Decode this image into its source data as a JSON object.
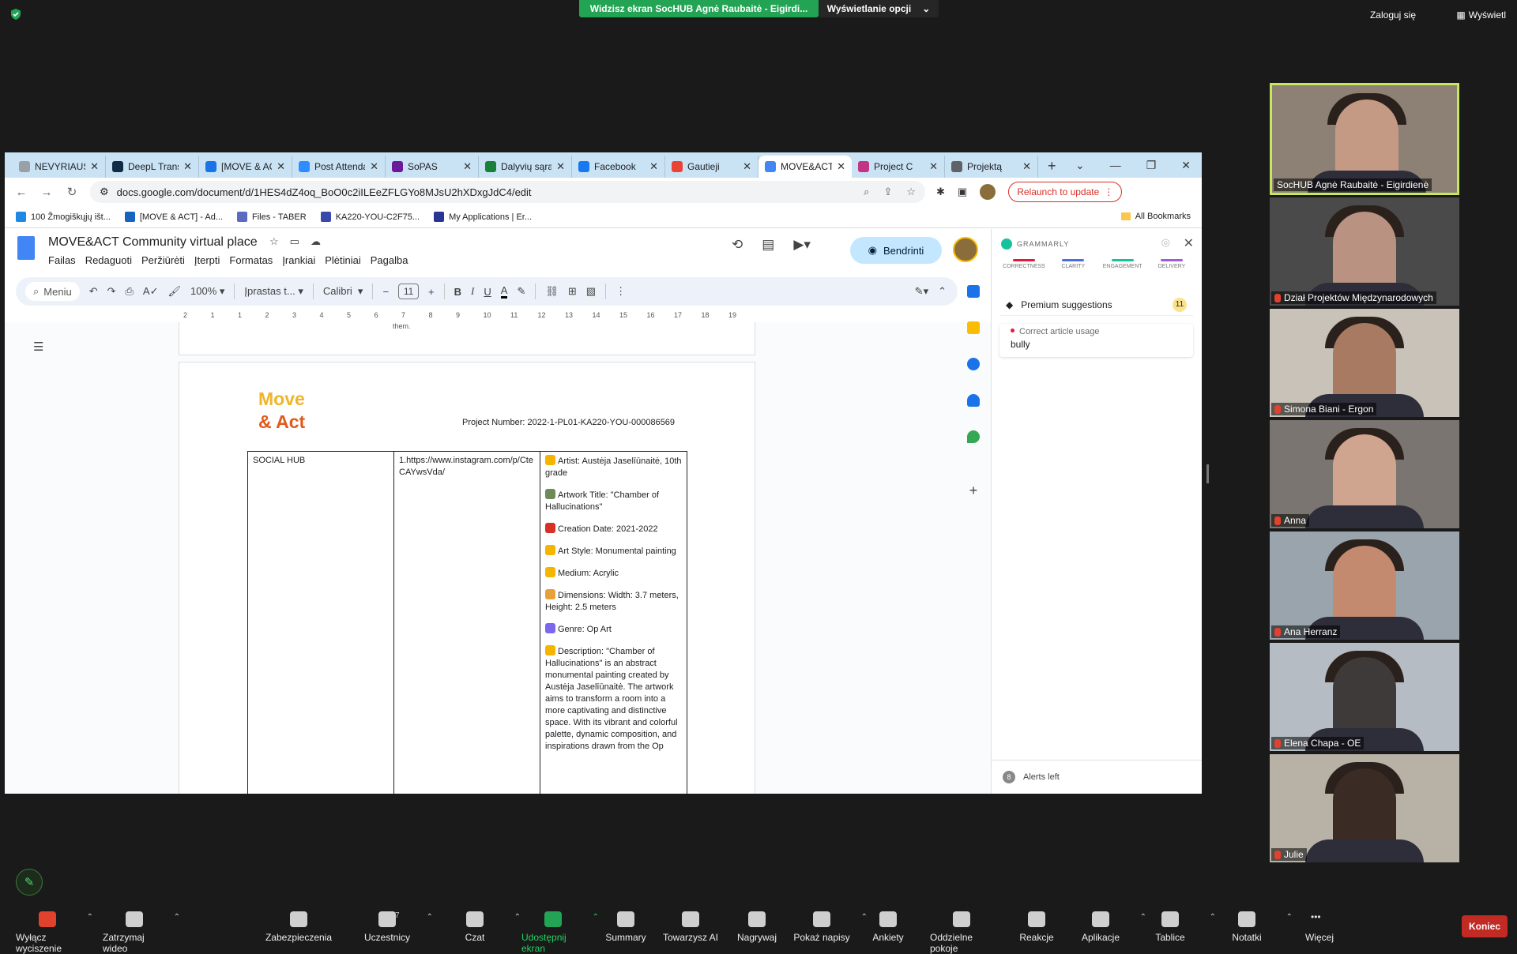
{
  "zoom_top": {
    "share_banner": "Widzisz ekran SocHUB Agnė Raubaitė - Eigirdi...",
    "view_options": "Wyświetlanie opcji",
    "login": "Zaloguj się",
    "show": "Wyświetl"
  },
  "browser": {
    "tabs": [
      {
        "label": "NEVYRIAUSYB",
        "color": "#9aa0a6"
      },
      {
        "label": "DeepL Translate",
        "color": "#0f2b46"
      },
      {
        "label": "[MOVE & ACT]",
        "color": "#1a73e8"
      },
      {
        "label": "Post Attendance",
        "color": "#2d8cff"
      },
      {
        "label": "SoPAS",
        "color": "#6a1b9a"
      },
      {
        "label": "Dalyvių sąrašas",
        "color": "#188038"
      },
      {
        "label": "Facebook",
        "color": "#1877f2"
      },
      {
        "label": "Gautieji",
        "color": "#ea4335"
      },
      {
        "label": "MOVE&ACT",
        "color": "#4285f4"
      },
      {
        "label": "Project C",
        "color": "#c13584"
      },
      {
        "label": "Projektą",
        "color": "#5f6368"
      }
    ],
    "url": "docs.google.com/document/d/1HES4dZ4oq_BoO0c2iILEeZFLGYo8MJsU2hXDxgJdC4/edit",
    "relaunch": "Relaunch to update",
    "bookmarks": [
      {
        "label": "100 Žmogiškųjų išt...",
        "color": "#1e88e5"
      },
      {
        "label": "[MOVE & ACT] - Ad...",
        "color": "#1565c0"
      },
      {
        "label": "Files - TABER",
        "color": "#5c6bc0"
      },
      {
        "label": "KA220-YOU-C2F75...",
        "color": "#3949ab"
      },
      {
        "label": "My Applications | Er...",
        "color": "#283593"
      }
    ],
    "all_bookmarks": "All Bookmarks"
  },
  "docs": {
    "title": "MOVE&ACT Community virtual place",
    "menu": [
      "Failas",
      "Redaguoti",
      "Peržiūrėti",
      "Įterpti",
      "Formatas",
      "Įrankiai",
      "Plėtiniai",
      "Pagalba"
    ],
    "share": "Bendrinti",
    "toolbar": {
      "search": "Meniu",
      "zoom": "100%",
      "style": "Įprastas t...",
      "font": "Calibri",
      "size": "11"
    },
    "ruler": [
      "2",
      "1",
      "1",
      "2",
      "3",
      "4",
      "5",
      "6",
      "7",
      "8",
      "9",
      "10",
      "11",
      "12",
      "13",
      "14",
      "15",
      "16",
      "17",
      "18",
      "19"
    ],
    "prev_page_text": "them.",
    "logo_line1": "Move",
    "logo_line2": "& Act",
    "project_number": "Project Number: 2022-1-PL01-KA220-YOU-000086569",
    "table": {
      "col1": "SOCIAL HUB",
      "col2": "1.https://www.instagram.com/p/CteCAYwsVda/",
      "col3": [
        {
          "text": "Artist: Austėja Jaselīūnaitė, 10th grade",
          "icon": "palette",
          "color": "#f4b400"
        },
        {
          "text": "Artwork Title: \"Chamber of Hallucinations\"",
          "icon": "framed-picture",
          "color": "#6d8b5a"
        },
        {
          "text": "Creation Date: 2021-2022",
          "icon": "calendar",
          "color": "#d93025"
        },
        {
          "text": "Art Style: Monumental painting",
          "icon": "palette",
          "color": "#f4b400"
        },
        {
          "text": "Medium: Acrylic",
          "icon": "palette",
          "color": "#f4b400"
        },
        {
          "text": "Dimensions: Width: 3.7 meters, Height: 2.5 meters",
          "icon": "triangle-ruler",
          "color": "#e8a13a"
        },
        {
          "text": "Genre: Op Art",
          "icon": "performing-arts",
          "color": "#7b68ee"
        },
        {
          "text": "Description: \"Chamber of Hallucinations\" is an abstract monumental painting created by Austėja Jaselīūnaitė. The artwork aims to transform a room into a more captivating and distinctive space. With its vibrant and colorful palette, dynamic composition, and inspirations drawn from the Op",
          "icon": "palette",
          "color": "#f4b400"
        }
      ]
    },
    "grammarly_badge_count": "8"
  },
  "grammarly": {
    "brand": "GRAMMARLY",
    "categories": [
      {
        "label": "CORRECTNESS",
        "color": "#e5173f"
      },
      {
        "label": "CLARITY",
        "color": "#4a6ee0"
      },
      {
        "label": "ENGAGEMENT",
        "color": "#15c39a"
      },
      {
        "label": "DELIVERY",
        "color": "#9c5bd9"
      }
    ],
    "premium": "Premium suggestions",
    "premium_count": "11",
    "card_kind": "Correct article usage",
    "card_word": "bully",
    "alerts_count": "8",
    "alerts_label": "Alerts left"
  },
  "participants": [
    {
      "name": "SocHUB Agnė Raubaitė - Eigirdienė",
      "muted": false,
      "bg": "#8d8074",
      "skin": "#c49a84"
    },
    {
      "name": "Dział Projektów Międzynarodowych",
      "muted": true,
      "bg": "#4a4a4a",
      "skin": "#b99282"
    },
    {
      "name": "Simona Biani - Ergon",
      "muted": true,
      "bg": "#c8c2b8",
      "skin": "#a87a62"
    },
    {
      "name": "Anna",
      "muted": true,
      "bg": "#7a7570",
      "skin": "#d0a590"
    },
    {
      "name": "Ana Herranz",
      "muted": true,
      "bg": "#9aa4ad",
      "skin": "#c48a70"
    },
    {
      "name": "Elena Chapa - OE",
      "muted": true,
      "bg": "#b5bcc3",
      "skin": "#3e3a3a"
    },
    {
      "name": "Julie",
      "muted": true,
      "bg": "#b8b1a6",
      "skin": "#3b2b25"
    }
  ],
  "zoom_bottom": {
    "items": [
      {
        "label": "Wyłącz wyciszenie",
        "caret": true
      },
      {
        "label": "Zatrzymaj wideo",
        "caret": true
      },
      {
        "label": "Zabezpieczenia",
        "caret": false
      },
      {
        "label": "Uczestnicy",
        "caret": true,
        "count": "7"
      },
      {
        "label": "Czat",
        "caret": true
      },
      {
        "label": "Udostępnij ekran",
        "caret": true
      },
      {
        "label": "Summary",
        "caret": false
      },
      {
        "label": "Towarzysz AI",
        "caret": false
      },
      {
        "label": "Nagrywaj",
        "caret": false
      },
      {
        "label": "Pokaż napisy",
        "caret": true
      },
      {
        "label": "Ankiety",
        "caret": false
      },
      {
        "label": "Oddzielne pokoje",
        "caret": false
      },
      {
        "label": "Reakcje",
        "caret": false
      },
      {
        "label": "Aplikacje",
        "caret": true
      },
      {
        "label": "Tablice",
        "caret": true
      },
      {
        "label": "Notatki",
        "caret": true
      },
      {
        "label": "Więcej",
        "caret": false
      }
    ],
    "end": "Koniec"
  }
}
